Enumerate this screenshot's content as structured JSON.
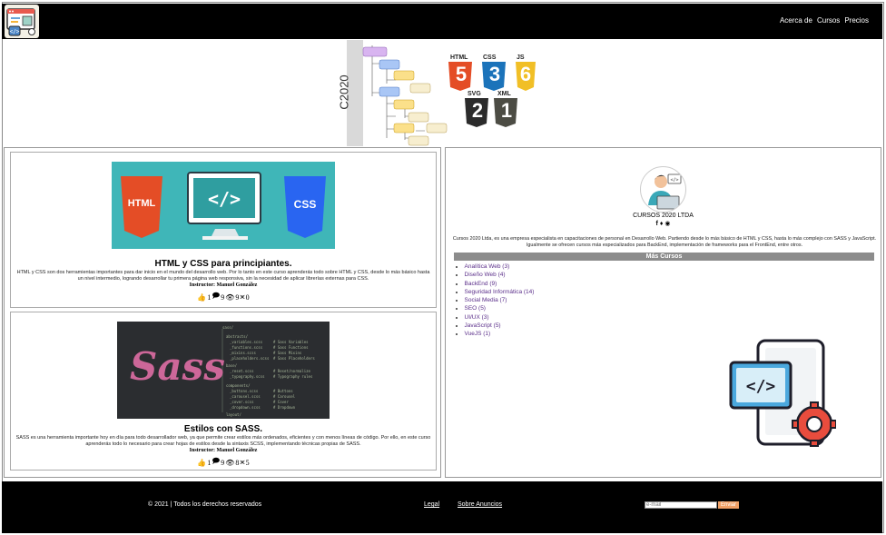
{
  "header": {
    "nav": [
      "Acerca de",
      "Cursos",
      "Precios"
    ]
  },
  "banner": {
    "title": "C2020",
    "badges": [
      "HTML",
      "CSS",
      "JS",
      "SVG",
      "XML"
    ],
    "badge_numbers": [
      "5",
      "3",
      "6",
      "2",
      "1"
    ]
  },
  "courses": [
    {
      "title": "HTML y CSS para principiantes.",
      "description": "HTML y CSS son dos herramientas importantes para dar inicio en el mundo del desarrollo web. Por lo tanto en este curso aprenderás todo sobre HTML y CSS, desde lo más básico hasta un nivel intermedio, logrando desarrollar tu primera página web responsiva, sin la necesidad de aplicar librerías externas para CSS.",
      "instructor": "Instructor: Manuel González",
      "likes": "1",
      "comments": "9",
      "views": "9",
      "shares": "0",
      "image_labels": [
        "HTML",
        "CSS"
      ]
    },
    {
      "title": "Estilos con SASS.",
      "description": "SASS es una herramienta importante hoy en día para todo desarrollador web, ya que permite crear estilos más ordenados, eficientes y con menos líneas de código. Por ello, en este curso aprenderás todo lo necesario para crear hojas de estilos desde la sintaxis SCSS, implementando técnicas propias de SASS.",
      "instructor": "Instructor: Manuel González",
      "likes": "1",
      "comments": "9",
      "views": "8",
      "shares": "5",
      "image_labels": [
        "Sass"
      ]
    }
  ],
  "sidebar": {
    "brand": "CURSOS 2020 LTDA",
    "about": "Cursos 2020 Ltda, es una empresa especialista en capacitaciones de personal en Desarrollo Web. Partiendo desde lo más básico de HTML y CSS, hasta lo más complejo con SASS y JavaScript. Igualmente se ofrecen cursos más especializados para BackEnd, implementación de frameworks para el FrontEnd, entre otros.",
    "more_title": "Más Cursos",
    "more_courses": [
      "Analítica Web (3)",
      "Diseño Web (4)",
      "BackEnd (9)",
      "Seguridad Informática (14)",
      "Social Media (7)",
      "SEO (5)",
      "UI/UX (3)",
      "JavaScript (5)",
      "VueJS (1)"
    ]
  },
  "footer": {
    "copyright": "© 2021 | Todos los derechos reservados",
    "legal": "Legal",
    "ads": "Sobre Anuncios",
    "email_placeholder": "e-mail",
    "send_label": "Enviar"
  },
  "colors": {
    "header_bg": "#000000",
    "link": "#5b2f8a",
    "section_head": "#8c8c8c",
    "send_button": "#f0a066"
  }
}
